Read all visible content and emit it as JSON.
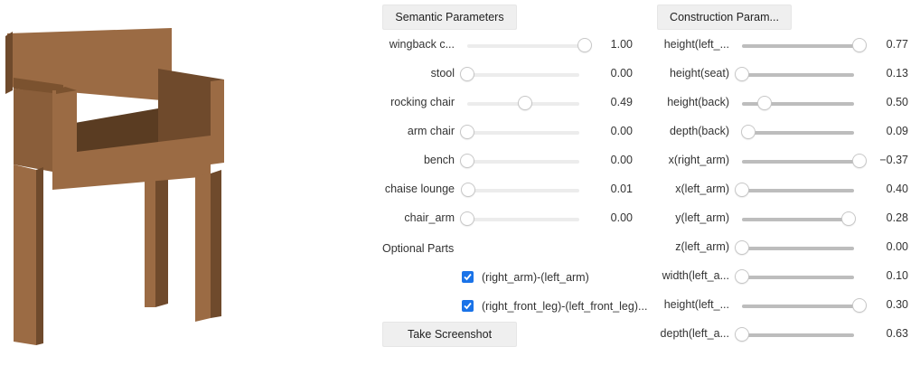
{
  "semantic": {
    "button_label": "Semantic Parameters",
    "sliders": [
      {
        "label": "wingback c...",
        "value": "1.00",
        "level": 1.0
      },
      {
        "label": "stool",
        "value": "0.00",
        "level": 0.0
      },
      {
        "label": "rocking chair",
        "value": "0.49",
        "level": 0.49
      },
      {
        "label": "arm chair",
        "value": "0.00",
        "level": 0.0
      },
      {
        "label": "bench",
        "value": "0.00",
        "level": 0.0
      },
      {
        "label": "chaise lounge",
        "value": "0.01",
        "level": 0.01
      },
      {
        "label": "chair_arm",
        "value": "0.00",
        "level": 0.0
      }
    ]
  },
  "optional_parts": {
    "title": "Optional Parts",
    "items": [
      {
        "label": "(right_arm)-(left_arm)",
        "checked": true
      },
      {
        "label": "(right_front_leg)-(left_front_leg)...",
        "checked": true
      }
    ]
  },
  "screenshot_button": {
    "label": "Take Screenshot"
  },
  "construction": {
    "button_label": "Construction Param...",
    "sliders": [
      {
        "label": "height(left_...",
        "value": "0.77",
        "level": 1.0
      },
      {
        "label": "height(seat)",
        "value": "0.13",
        "level": 0.0
      },
      {
        "label": "height(back)",
        "value": "0.50",
        "level": 0.19
      },
      {
        "label": "depth(back)",
        "value": "0.09",
        "level": 0.05
      },
      {
        "label": "x(right_arm)",
        "value": "−0.37",
        "level": 1.0
      },
      {
        "label": "x(left_arm)",
        "value": "0.40",
        "level": 0.0
      },
      {
        "label": "y(left_arm)",
        "value": "0.28",
        "level": 0.91
      },
      {
        "label": "z(left_arm)",
        "value": "0.00",
        "level": 0.0
      },
      {
        "label": "width(left_a...",
        "value": "0.10",
        "level": 0.0
      },
      {
        "label": "height(left_...",
        "value": "0.30",
        "level": 1.0
      },
      {
        "label": "depth(left_a...",
        "value": "0.63",
        "level": 0.0
      }
    ]
  },
  "colors": {
    "wood_front": "#9b6b44",
    "wood_side": "#6f4a2c",
    "wood_dark": "#5a3c22",
    "checkbox_blue": "#1a73e8"
  }
}
